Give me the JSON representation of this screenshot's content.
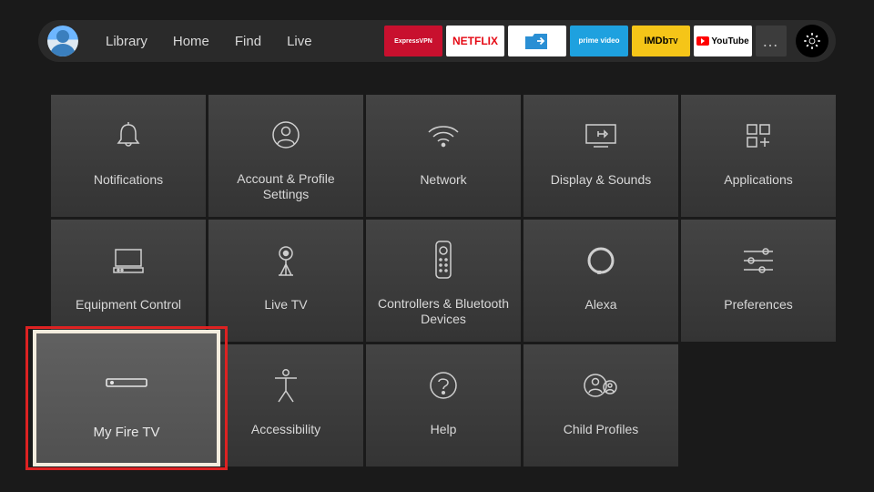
{
  "nav": {
    "items": [
      "Library",
      "Home",
      "Find",
      "Live"
    ]
  },
  "apps": {
    "expressvpn": "ExpressVPN",
    "netflix": "NETFLIX",
    "es": "ES",
    "primevideo": "prime video",
    "imdbtv": "IMDb TV",
    "youtube": "YouTube",
    "more": "…"
  },
  "tiles": [
    {
      "id": "notifications",
      "label": "Notifications"
    },
    {
      "id": "account",
      "label": "Account & Profile Settings"
    },
    {
      "id": "network",
      "label": "Network"
    },
    {
      "id": "display",
      "label": "Display & Sounds"
    },
    {
      "id": "applications",
      "label": "Applications"
    },
    {
      "id": "equipment",
      "label": "Equipment Control"
    },
    {
      "id": "livetv",
      "label": "Live TV"
    },
    {
      "id": "controllers",
      "label": "Controllers & Bluetooth Devices"
    },
    {
      "id": "alexa",
      "label": "Alexa"
    },
    {
      "id": "preferences",
      "label": "Preferences"
    },
    {
      "id": "myfiretv",
      "label": "My Fire TV"
    },
    {
      "id": "accessibility",
      "label": "Accessibility"
    },
    {
      "id": "help",
      "label": "Help"
    },
    {
      "id": "childprofiles",
      "label": "Child Profiles"
    }
  ],
  "selected": "myfiretv"
}
